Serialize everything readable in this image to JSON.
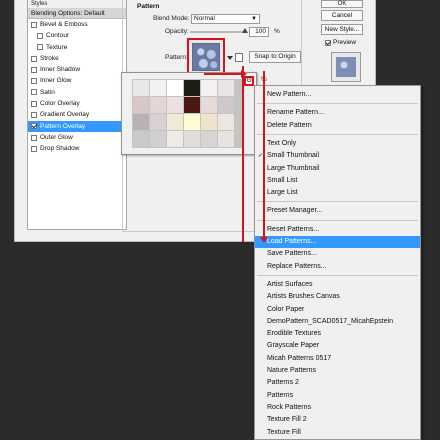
{
  "styles_panel": {
    "title": "Styles",
    "blending_options": "Blending Options: Default",
    "items": [
      {
        "label": "Bevel & Emboss",
        "checked": false,
        "sub": false,
        "selected": false
      },
      {
        "label": "Contour",
        "checked": false,
        "sub": true,
        "selected": false
      },
      {
        "label": "Texture",
        "checked": false,
        "sub": true,
        "selected": false
      },
      {
        "label": "Stroke",
        "checked": false,
        "sub": false,
        "selected": false
      },
      {
        "label": "Inner Shadow",
        "checked": false,
        "sub": false,
        "selected": false
      },
      {
        "label": "Inner Glow",
        "checked": false,
        "sub": false,
        "selected": false
      },
      {
        "label": "Satin",
        "checked": false,
        "sub": false,
        "selected": false
      },
      {
        "label": "Color Overlay",
        "checked": false,
        "sub": false,
        "selected": false
      },
      {
        "label": "Gradient Overlay",
        "checked": false,
        "sub": false,
        "selected": false
      },
      {
        "label": "Pattern Overlay",
        "checked": true,
        "sub": false,
        "selected": true
      },
      {
        "label": "Outer Glow",
        "checked": false,
        "sub": false,
        "selected": false
      },
      {
        "label": "Drop Shadow",
        "checked": false,
        "sub": false,
        "selected": false
      }
    ]
  },
  "pattern_section": {
    "legend": "Pattern",
    "blend_mode_label": "Blend Mode:",
    "blend_mode_value": "Normal",
    "opacity_label": "Opacity:",
    "opacity_value": "100",
    "opacity_unit": "%",
    "pattern_label": "Pattern:",
    "snap_button": "Snap to Origin",
    "percent_sign": "%"
  },
  "buttons": {
    "ok": "OK",
    "cancel": "Cancel",
    "new_style": "New Style...",
    "preview": "Preview"
  },
  "picker_swatches": [
    "#e9e6ea",
    "#f2f2f2",
    "#ffffff",
    "#1d1d12",
    "#f4f1f4",
    "#e7e3e7",
    "#d8c6c8",
    "#e4d6d8",
    "#ecdfe0",
    "#4a1a12",
    "#e5dad8",
    "#cfc8ca",
    "#b9b2b4",
    "#d9d1d1",
    "#efe9d5",
    "#fffbd0",
    "#f1e3c9",
    "#eae6e4",
    "#c9c9c9",
    "#d2cfcf",
    "#f0eae4",
    "#e1ddd9",
    "#d8d4d2",
    "#e6e2df"
  ],
  "menu": {
    "items": [
      {
        "label": "New Pattern...",
        "checked": false,
        "highlight": false
      },
      {
        "separator": true
      },
      {
        "label": "Rename Pattern...",
        "checked": false,
        "highlight": false
      },
      {
        "label": "Delete Pattern",
        "checked": false,
        "highlight": false
      },
      {
        "separator": true
      },
      {
        "label": "Text Only",
        "checked": false,
        "highlight": false
      },
      {
        "label": "Small Thumbnail",
        "checked": true,
        "highlight": false
      },
      {
        "label": "Large Thumbnail",
        "checked": false,
        "highlight": false
      },
      {
        "label": "Small List",
        "checked": false,
        "highlight": false
      },
      {
        "label": "Large List",
        "checked": false,
        "highlight": false
      },
      {
        "separator": true
      },
      {
        "label": "Preset Manager...",
        "checked": false,
        "highlight": false
      },
      {
        "separator": true
      },
      {
        "label": "Reset Patterns...",
        "checked": false,
        "highlight": false
      },
      {
        "label": "Load Patterns...",
        "checked": false,
        "highlight": true
      },
      {
        "label": "Save Patterns...",
        "checked": false,
        "highlight": false
      },
      {
        "label": "Replace Patterns...",
        "checked": false,
        "highlight": false
      },
      {
        "separator": true
      },
      {
        "label": "Artist Surfaces",
        "checked": false,
        "highlight": false
      },
      {
        "label": "Artists Brushes Canvas",
        "checked": false,
        "highlight": false
      },
      {
        "label": "Color Paper",
        "checked": false,
        "highlight": false
      },
      {
        "label": "DemoPattern_SCAD0517_MicahEpstein",
        "checked": false,
        "highlight": false
      },
      {
        "label": "Erodible Textures",
        "checked": false,
        "highlight": false
      },
      {
        "label": "Grayscale Paper",
        "checked": false,
        "highlight": false
      },
      {
        "label": "Micah Patterns 0517",
        "checked": false,
        "highlight": false
      },
      {
        "label": "Nature Patterns",
        "checked": false,
        "highlight": false
      },
      {
        "label": "Patterns 2",
        "checked": false,
        "highlight": false
      },
      {
        "label": "Patterns",
        "checked": false,
        "highlight": false
      },
      {
        "label": "Rock Patterns",
        "checked": false,
        "highlight": false
      },
      {
        "label": "Texture Fill 2",
        "checked": false,
        "highlight": false
      },
      {
        "label": "Texture Fill",
        "checked": false,
        "highlight": false
      }
    ]
  },
  "colors": {
    "accent": "#3399ff",
    "annotation_red": "#d6141d",
    "background": "#2b2b2b"
  }
}
